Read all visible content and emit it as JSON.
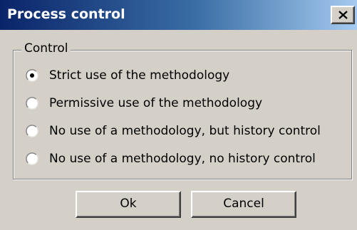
{
  "window": {
    "title": "Process control",
    "close_icon": "close-x-icon"
  },
  "group": {
    "label": "Control",
    "options": [
      {
        "label": "Strict use of the methodology",
        "selected": true
      },
      {
        "label": "Permissive use of the methodology",
        "selected": false
      },
      {
        "label": "No use of a methodology, but history control",
        "selected": false
      },
      {
        "label": "No use of a methodology, no history control",
        "selected": false
      }
    ]
  },
  "buttons": {
    "ok_label": "Ok",
    "cancel_label": "Cancel"
  },
  "colors": {
    "titlebar_start": "#0a246a",
    "titlebar_end": "#a6caf0",
    "face": "#d4d0c8"
  }
}
